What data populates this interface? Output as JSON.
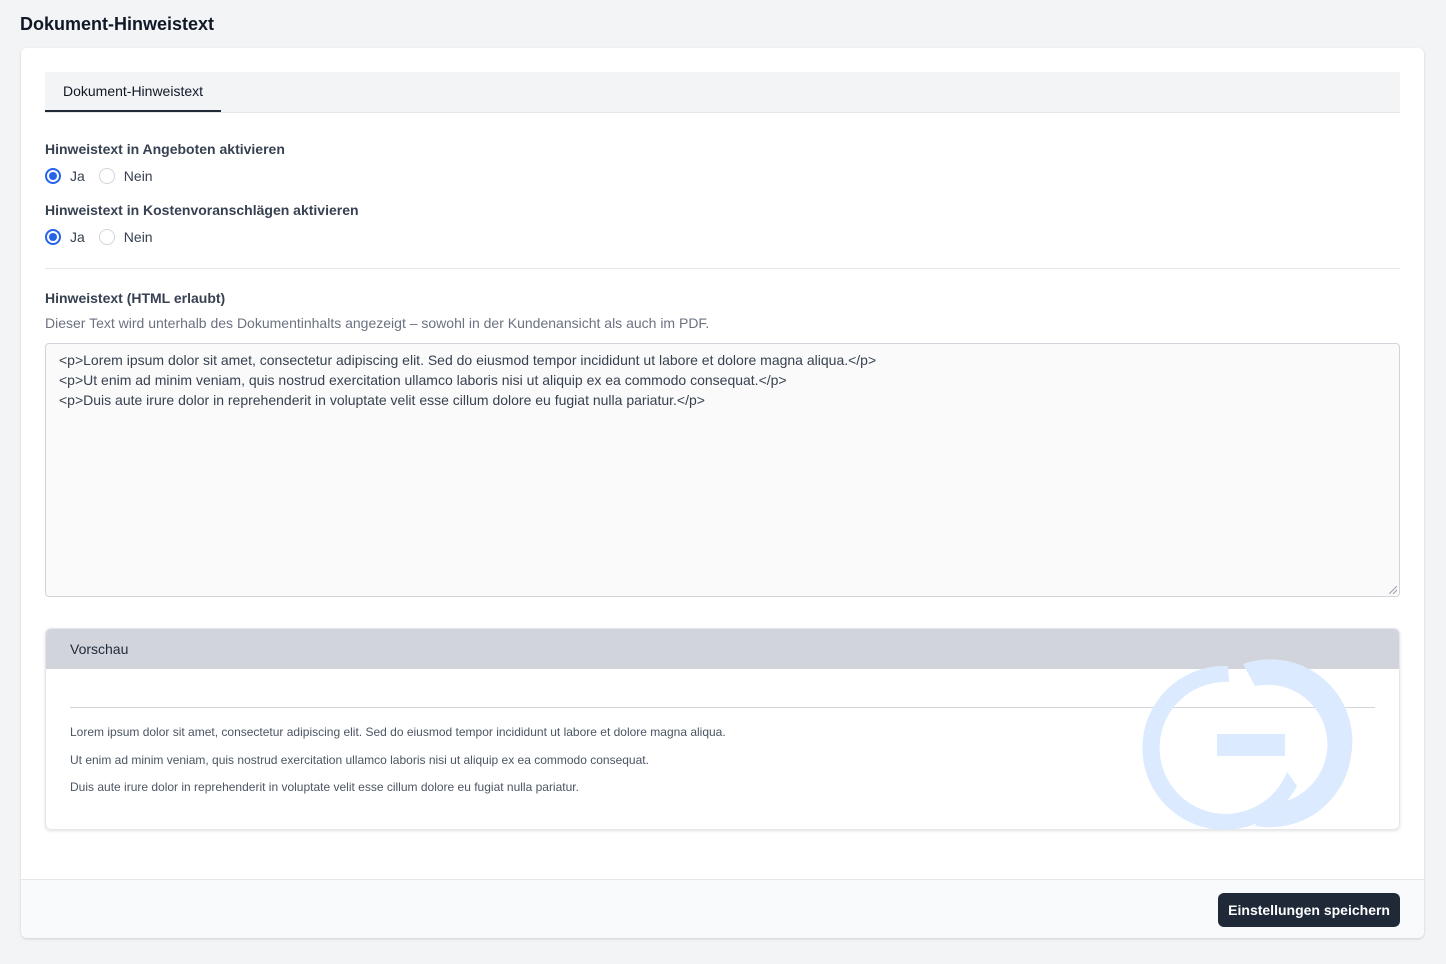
{
  "page": {
    "title": "Dokument-Hinweistext"
  },
  "tabs": [
    {
      "label": "Dokument-Hinweistext",
      "active": true
    }
  ],
  "settings": {
    "offers": {
      "label": "Hinweistext in Angeboten aktivieren",
      "options": [
        "Ja",
        "Nein"
      ],
      "selected": "Ja"
    },
    "estimates": {
      "label": "Hinweistext in Kostenvoranschlägen aktivieren",
      "options": [
        "Ja",
        "Nein"
      ],
      "selected": "Ja"
    }
  },
  "editor": {
    "label": "Hinweistext (HTML erlaubt)",
    "help": "Dieser Text wird unterhalb des Dokumentinhalts angezeigt – sowohl in der Kundenansicht als auch im PDF.",
    "lines": [
      "<p>Lorem ipsum dolor sit amet, consectetur adipiscing elit. Sed do eiusmod tempor incididunt ut labore et dolore magna aliqua.</p>",
      "<p>Ut enim ad minim veniam, quis nostrud exercitation ullamco laboris nisi ut aliquip ex ea commodo consequat.</p>",
      "<p>Duis aute irure dolor in reprehenderit in voluptate velit esse cillum dolore eu fugiat nulla pariatur.</p>"
    ]
  },
  "preview": {
    "title": "Vorschau",
    "paragraphs": [
      "Lorem ipsum dolor sit amet, consectetur adipiscing elit. Sed do eiusmod tempor incididunt ut labore et dolore magna aliqua.",
      "Ut enim ad minim veniam, quis nostrud exercitation ullamco laboris nisi ut aliquip ex ea commodo consequat.",
      "Duis aute irure dolor in reprehenderit in voluptate velit esse cillum dolore eu fugiat nulla pariatur."
    ]
  },
  "footer": {
    "save_label": "Einstellungen speichern"
  },
  "colors": {
    "accent": "#2563eb",
    "button_bg": "#1f2937",
    "preview_header_bg": "#d1d5db",
    "watermark": "#dbeafe"
  },
  "icons": {
    "watermark": "brand-logo-icon"
  }
}
